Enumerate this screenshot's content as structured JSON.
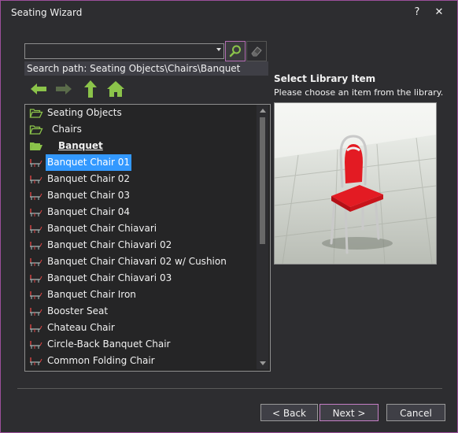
{
  "window": {
    "title": "Seating Wizard",
    "help_label": "?",
    "close_label": "✕"
  },
  "search": {
    "value": "",
    "search_icon": "search-icon",
    "clear_icon": "eraser-icon"
  },
  "search_path": "Search path: Seating Objects\\Chairs\\Banquet",
  "nav": {
    "back_icon": "arrow-left-icon",
    "forward_icon": "arrow-right-icon",
    "up_icon": "arrow-up-icon",
    "home_icon": "home-icon"
  },
  "tree": {
    "items": [
      {
        "label": "Seating Objects",
        "icon": "folder-open-icon",
        "indent": 0,
        "selected": false,
        "bold": false
      },
      {
        "label": "Chairs",
        "icon": "folder-open-icon",
        "indent": 0,
        "selected": false,
        "bold": false
      },
      {
        "label": "Banquet",
        "icon": "folder-open-filled-icon",
        "indent": 0,
        "selected": false,
        "bold": true
      },
      {
        "label": "Banquet Chair 01",
        "icon": "chair-icon",
        "indent": 0,
        "selected": true,
        "bold": false
      },
      {
        "label": "Banquet Chair 02",
        "icon": "chair-icon",
        "indent": 0,
        "selected": false,
        "bold": false
      },
      {
        "label": "Banquet Chair 03",
        "icon": "chair-icon",
        "indent": 0,
        "selected": false,
        "bold": false
      },
      {
        "label": "Banquet Chair 04",
        "icon": "chair-icon",
        "indent": 0,
        "selected": false,
        "bold": false
      },
      {
        "label": "Banquet Chair Chiavari",
        "icon": "chair-icon",
        "indent": 0,
        "selected": false,
        "bold": false
      },
      {
        "label": "Banquet Chair Chiavari 02",
        "icon": "chair-icon",
        "indent": 0,
        "selected": false,
        "bold": false
      },
      {
        "label": "Banquet Chair Chiavari 02 w/ Cushion",
        "icon": "chair-icon",
        "indent": 0,
        "selected": false,
        "bold": false
      },
      {
        "label": "Banquet Chair Chiavari 03",
        "icon": "chair-icon",
        "indent": 0,
        "selected": false,
        "bold": false
      },
      {
        "label": "Banquet Chair Iron",
        "icon": "chair-icon",
        "indent": 0,
        "selected": false,
        "bold": false
      },
      {
        "label": "Booster Seat",
        "icon": "chair-icon",
        "indent": 0,
        "selected": false,
        "bold": false
      },
      {
        "label": "Chateau Chair",
        "icon": "chair-icon",
        "indent": 0,
        "selected": false,
        "bold": false
      },
      {
        "label": "Circle-Back Banquet Chair",
        "icon": "chair-icon",
        "indent": 0,
        "selected": false,
        "bold": false
      },
      {
        "label": "Common Folding Chair",
        "icon": "chair-icon",
        "indent": 0,
        "selected": false,
        "bold": false
      }
    ]
  },
  "library": {
    "title": "Select Library Item",
    "subtitle": "Please choose an item from the library."
  },
  "buttons": {
    "back": "< Back",
    "next": "Next >",
    "cancel": "Cancel"
  },
  "colors": {
    "accent": "#3399ff",
    "folder": "#8bc34a",
    "highlight_border": "#b36db3",
    "chair_red": "#e31b23"
  }
}
